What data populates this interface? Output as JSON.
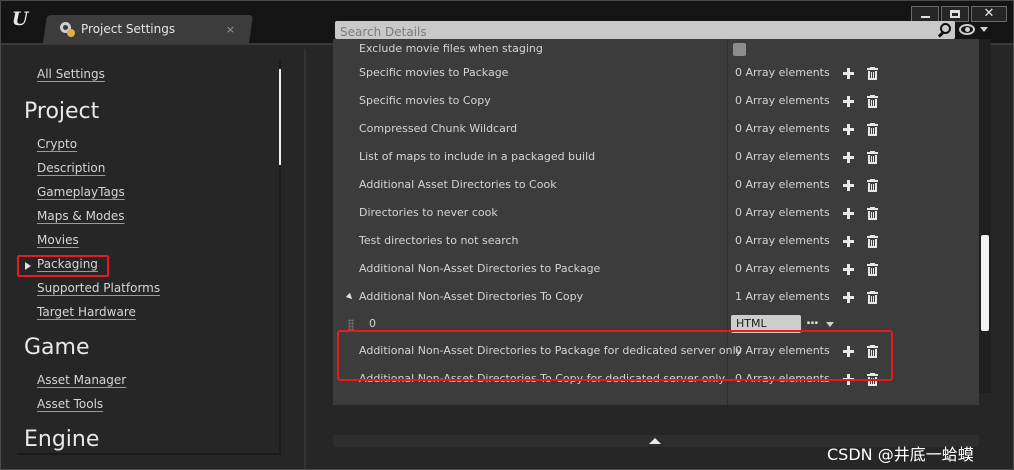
{
  "window": {
    "tab_title": "Project Settings",
    "tab_close": "×",
    "close_glyph": "✕"
  },
  "sidebar": {
    "top_link": "All Settings",
    "sections": [
      {
        "heading": "Project",
        "items": [
          "Crypto",
          "Description",
          "GameplayTags",
          "Maps & Modes",
          "Movies",
          "Packaging",
          "Supported Platforms",
          "Target Hardware"
        ]
      },
      {
        "heading": "Game",
        "items": [
          "Asset Manager",
          "Asset Tools"
        ]
      },
      {
        "heading": "Engine",
        "items": []
      }
    ],
    "selected_item": "Packaging"
  },
  "search": {
    "placeholder": "Search Details"
  },
  "details": {
    "rows": [
      {
        "name": "Exclude movie files when staging",
        "value": ""
      },
      {
        "name": "Specific movies to Package",
        "value": "0 Array elements"
      },
      {
        "name": "Specific movies to Copy",
        "value": "0 Array elements"
      },
      {
        "name": "Compressed Chunk Wildcard",
        "value": "0 Array elements"
      },
      {
        "name": "List of maps to include in a packaged build",
        "value": "0 Array elements"
      },
      {
        "name": "Additional Asset Directories to Cook",
        "value": "0 Array elements"
      },
      {
        "name": "Directories to never cook",
        "value": "0 Array elements"
      },
      {
        "name": "Test directories to not search",
        "value": "0 Array elements"
      },
      {
        "name": "Additional Non-Asset Directories to Package",
        "value": "0 Array elements"
      },
      {
        "name": "Additional Non-Asset Directories To Copy",
        "value": "1 Array elements"
      },
      {
        "name": "Additional Non-Asset Directories to Package for dedicated server only",
        "value": "0 Array elements"
      },
      {
        "name": "Additional Non-Asset Directories To Copy for dedicated server only",
        "value": "0 Array elements"
      }
    ],
    "array_element": {
      "index": "0",
      "value": "HTML",
      "browse": "..."
    }
  },
  "watermark": "CSDN @井底一蛤蟆",
  "colors": {
    "highlight": "#e51c1c",
    "panel": "#262626",
    "details_bg": "#3c3c3c"
  }
}
